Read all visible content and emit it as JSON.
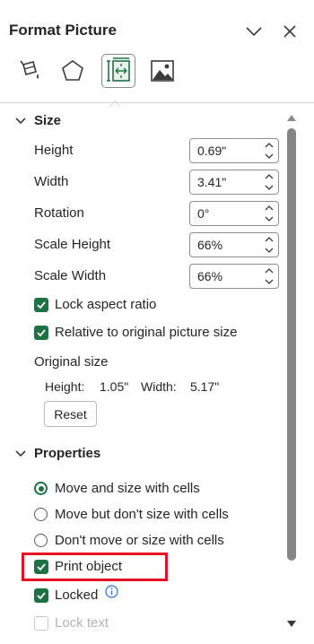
{
  "panel": {
    "title": "Format Picture",
    "collapse_icon": "chevron-down-icon",
    "close_icon": "close-icon"
  },
  "tabs": [
    {
      "name": "Fill & Line",
      "icon": "paint-bucket-icon",
      "selected": false
    },
    {
      "name": "Effects",
      "icon": "pentagon-icon",
      "selected": false
    },
    {
      "name": "Size & Properties",
      "icon": "size-properties-icon",
      "selected": true
    },
    {
      "name": "Picture",
      "icon": "picture-icon",
      "selected": false
    }
  ],
  "size": {
    "header": "Size",
    "height_label": "Height",
    "height_value": "0.69\"",
    "width_label": "Width",
    "width_value": "3.41\"",
    "rotation_label": "Rotation",
    "rotation_value": "0°",
    "scale_height_label": "Scale Height",
    "scale_height_value": "66%",
    "scale_width_label": "Scale Width",
    "scale_width_value": "66%",
    "lock_aspect_label": "Lock aspect ratio",
    "lock_aspect_checked": true,
    "relative_label": "Relative to original picture size",
    "relative_checked": true,
    "original_size_label": "Original size",
    "orig_height_label": "Height:",
    "orig_height_value": "1.05\"",
    "orig_width_label": "Width:",
    "orig_width_value": "5.17\"",
    "reset_label": "Reset"
  },
  "properties": {
    "header": "Properties",
    "move_size_label": "Move and size with cells",
    "move_only_label": "Move but don't size with cells",
    "no_move_label": "Don't move or size with cells",
    "selected_option": "Move and size with cells",
    "print_object_label": "Print object",
    "print_object_checked": true,
    "locked_label": "Locked",
    "locked_checked": true,
    "lock_text_label": "Lock text",
    "lock_text_checked": false,
    "lock_text_disabled": true
  },
  "colors": {
    "accent": "#1f7145",
    "highlight": "#e81123"
  }
}
